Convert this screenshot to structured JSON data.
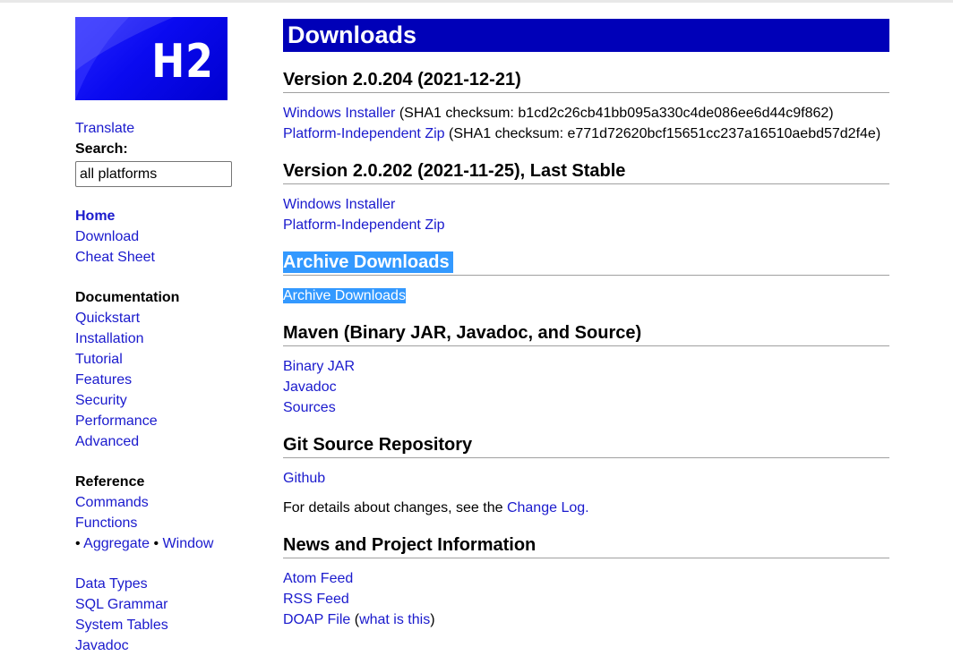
{
  "logo": {
    "text": "H2"
  },
  "sidebar": {
    "translate": "Translate",
    "search_label": "Search:",
    "search_value": "all platforms",
    "nav1": [
      "Home",
      "Download",
      "Cheat Sheet"
    ],
    "documentation": {
      "heading": "Documentation",
      "items": [
        "Quickstart",
        "Installation",
        "Tutorial",
        "Features",
        "Security",
        "Performance",
        "Advanced"
      ]
    },
    "reference": {
      "heading": "Reference",
      "items": [
        "Commands",
        "Functions"
      ],
      "bullet": "•",
      "aggregate": "Aggregate",
      "window": "Window"
    },
    "more": [
      "Data Types",
      "SQL Grammar",
      "System Tables",
      "Javadoc"
    ]
  },
  "main": {
    "title": "Downloads",
    "v204": {
      "heading": "Version 2.0.204 (2021-12-21)",
      "installer": "Windows Installer",
      "installer_sha": "(SHA1 checksum: b1cd2c26cb41bb095a330c4de086ee6d44c9f862)",
      "zip": "Platform-Independent Zip",
      "zip_sha": "(SHA1 checksum: e771d72620bcf15651cc237a16510aebd57d2f4e)"
    },
    "v202": {
      "heading": "Version 2.0.202 (2021-11-25), Last Stable",
      "installer": "Windows Installer",
      "zip": "Platform-Independent Zip"
    },
    "archive": {
      "heading": "Archive Downloads",
      "link": "Archive Downloads"
    },
    "maven": {
      "heading": "Maven (Binary JAR, Javadoc, and Source)",
      "links": [
        "Binary JAR",
        "Javadoc",
        "Sources"
      ]
    },
    "git": {
      "heading": "Git Source Repository",
      "link": "Github",
      "details_prefix": "For details about changes, see the",
      "changelog": "Change Log",
      "details_suffix": "."
    },
    "news": {
      "heading": "News and Project Information",
      "atom": "Atom Feed",
      "rss": "RSS Feed",
      "doap": "DOAP File",
      "paren_open": "(",
      "what": "what is this",
      "paren_close": ")"
    }
  },
  "colors": {
    "link": "#1a1acd",
    "title_bg": "#0000b8",
    "selection": "#3399ff"
  }
}
